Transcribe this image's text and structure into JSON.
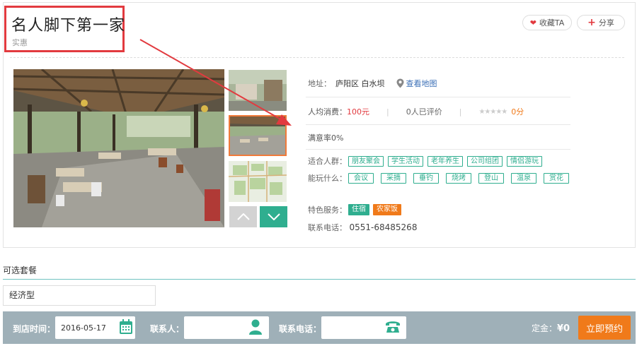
{
  "header": {
    "title": "名人脚下第一家",
    "subtitle": "实惠",
    "fav_label": "收藏TA",
    "share_label": "分享"
  },
  "info": {
    "address_label": "地址：",
    "address_value": "庐阳区 白水坝",
    "map_link": "查看地图",
    "consume_label": "人均消费：",
    "consume_value": "100元",
    "reviews": "0人已评价",
    "score": "0分",
    "rating": 0,
    "satisfaction": "满意率0%",
    "crowd_label": "适合人群：",
    "crowd_tags": [
      "朋友聚会",
      "学生活动",
      "老年养生",
      "公司组团",
      "情侣游玩"
    ],
    "play_label": "能玩什么：",
    "play_tags": [
      "会议",
      "采摘",
      "垂钓",
      "烧烤",
      "登山",
      "温泉",
      "赏花"
    ],
    "special_label": "特色服务：",
    "special_tags": [
      "住宿",
      "农家饭"
    ],
    "phone_label": "联系电话：",
    "phone_value": "0551-68485268"
  },
  "package": {
    "title": "可选套餐",
    "selected": "经济型"
  },
  "booking": {
    "date_label": "到店时间：",
    "date_value": "2016-05-17",
    "contact_label": "联系人：",
    "phone_label": "联系电话：",
    "deposit_label": "定金：",
    "deposit_value": "¥0",
    "book_label": "立即预约"
  },
  "colors": {
    "accent_red": "#e23a3f",
    "green": "#2fae8f",
    "orange": "#f07a1a",
    "bar_bg": "#9fb0b8"
  }
}
